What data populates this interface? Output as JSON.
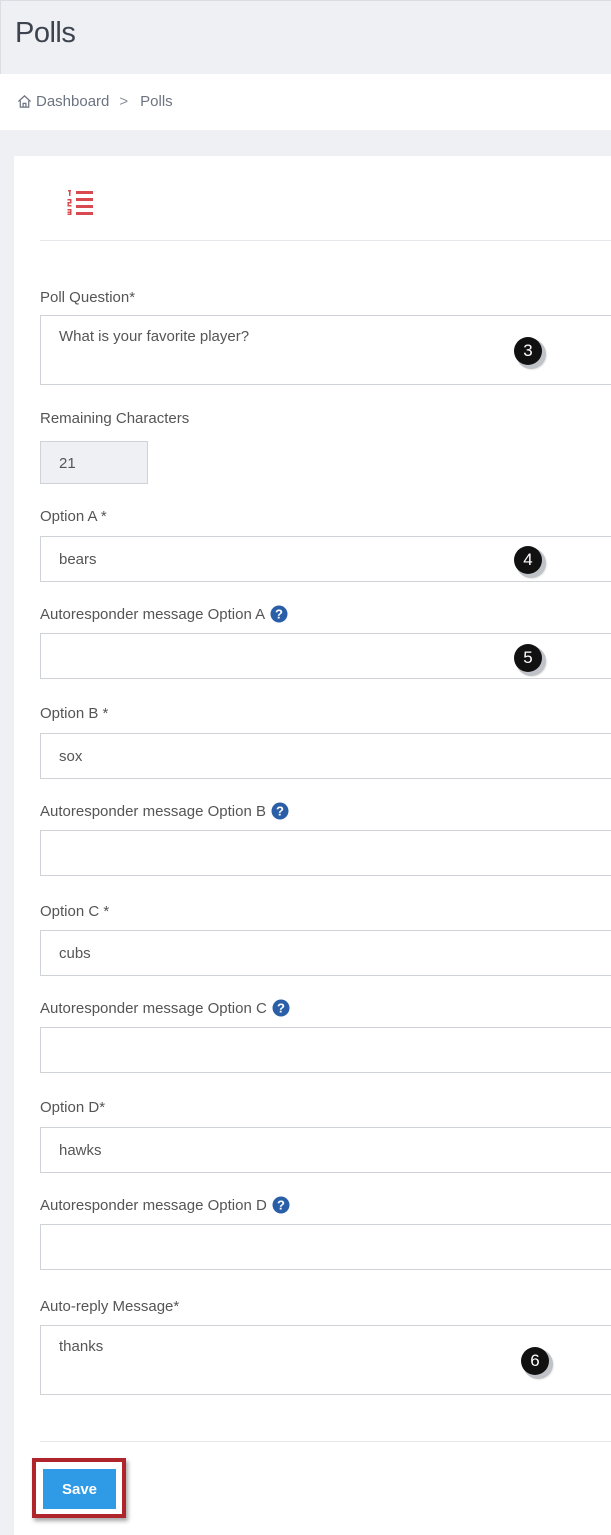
{
  "header": {
    "title": "Polls"
  },
  "breadcrumb": {
    "home": "Dashboard",
    "separator": ">",
    "current": "Polls"
  },
  "form": {
    "poll_question": {
      "label": "Poll Question*",
      "value": "What is your favorite player?"
    },
    "remaining": {
      "label": "Remaining Characters",
      "value": "21"
    },
    "option_a": {
      "label": "Option A *",
      "value": "bears"
    },
    "auto_a": {
      "label": "Autoresponder message Option A",
      "value": ""
    },
    "option_b": {
      "label": "Option B *",
      "value": "sox"
    },
    "auto_b": {
      "label": "Autoresponder message Option B",
      "value": ""
    },
    "option_c": {
      "label": "Option C *",
      "value": "cubs"
    },
    "auto_c": {
      "label": "Autoresponder message Option C",
      "value": ""
    },
    "option_d": {
      "label": "Option D*",
      "value": "hawks"
    },
    "auto_d": {
      "label": "Autoresponder message Option D",
      "value": ""
    },
    "auto_reply": {
      "label": "Auto-reply Message*",
      "value": "thanks"
    }
  },
  "callouts": [
    "3",
    "4",
    "5",
    "6"
  ],
  "save_label": "Save",
  "icons": {
    "home": "home-icon",
    "list": "numbered-list-icon",
    "help": "question-circle-icon"
  },
  "colors": {
    "accent": "#2f9be6",
    "list_icon": "#d84a4f",
    "highlight_border": "#b0242b",
    "help_icon": "#2a5fa8"
  }
}
